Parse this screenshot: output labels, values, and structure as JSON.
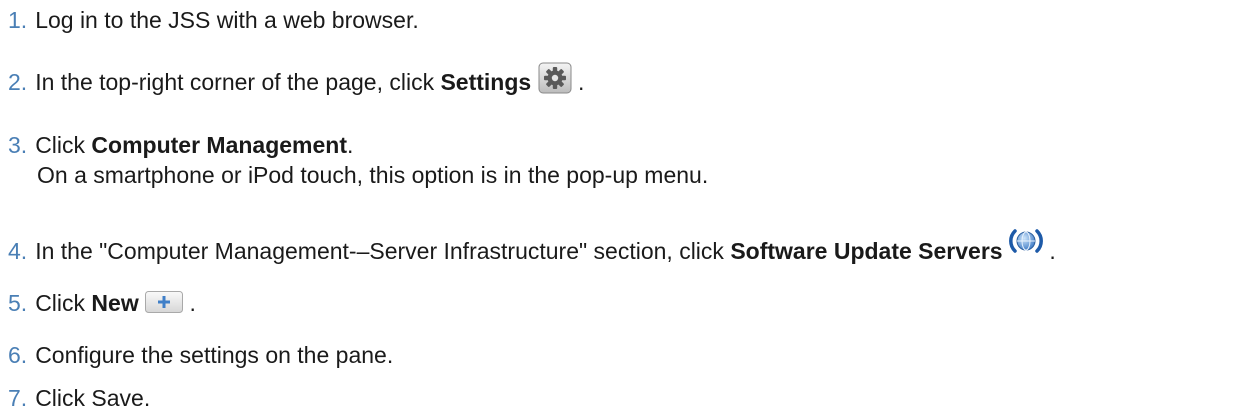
{
  "steps": [
    {
      "num": "1.",
      "text": "Log in to the JSS with a web browser."
    },
    {
      "num": "2.",
      "pre": "In the top-right corner of the page, click ",
      "bold": "Settings",
      "post": " ."
    },
    {
      "num": "3.",
      "pre": "Click ",
      "bold": "Computer Management",
      "post": ".",
      "sub": "On a smartphone or iPod touch, this option is in the pop-up menu."
    },
    {
      "num": "4.",
      "pre": "In the \"Computer Management-–Server Infrastructure\" section, click ",
      "bold": "Software Update Servers",
      "post": " ."
    },
    {
      "num": "5.",
      "pre": "Click ",
      "bold": "New",
      "post": " ."
    },
    {
      "num": "6.",
      "text": "Configure the settings on the pane."
    },
    {
      "num": "7.",
      "text": "Click Save."
    }
  ],
  "icons": {
    "settings": "gear-icon",
    "software_update_servers": "globe-sync-icon",
    "new": "plus-icon"
  }
}
